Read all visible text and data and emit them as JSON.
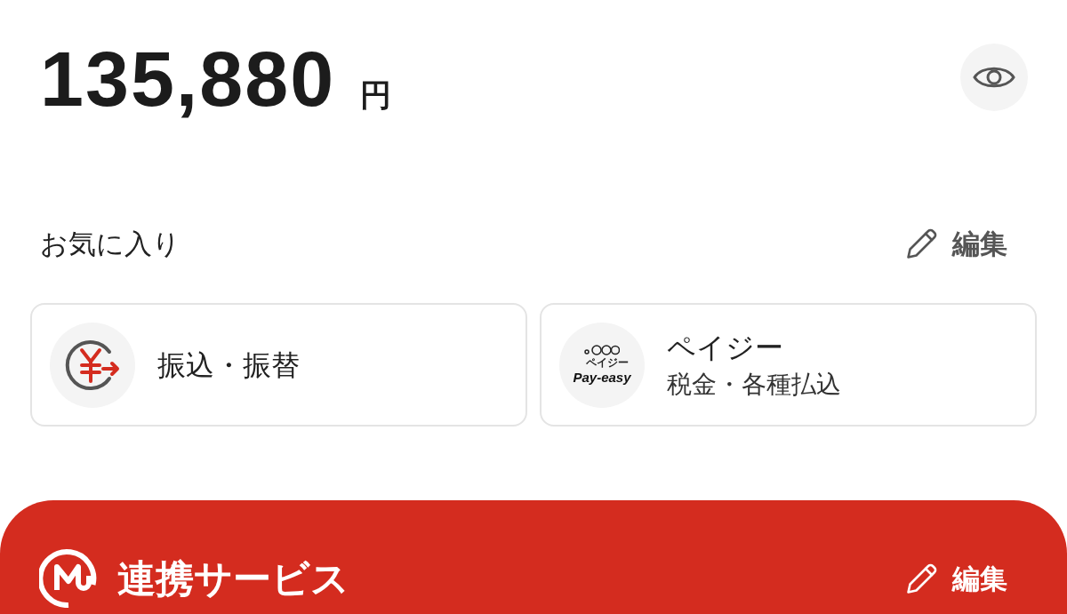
{
  "balance": {
    "amount": "135,880",
    "currency": "円"
  },
  "favorites": {
    "title": "お気に入り",
    "edit_label": "編集",
    "items": [
      {
        "kind": "transfer",
        "title": "振込・振替"
      },
      {
        "kind": "payeasy",
        "title": "ペイジー",
        "subtitle": "税金・各種払込",
        "logo": {
          "caption": "ペイジー",
          "name": "Pay-easy"
        }
      }
    ]
  },
  "linked_services": {
    "title": "連携サービス",
    "edit_label": "編集"
  }
}
